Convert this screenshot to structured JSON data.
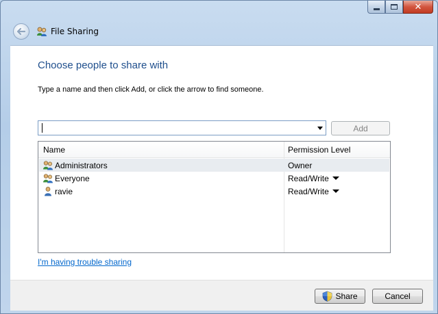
{
  "window": {
    "title": "File Sharing",
    "controls": {
      "minimize": "minimize",
      "maximize": "maximize",
      "close": "close"
    }
  },
  "dialog": {
    "heading": "Choose people to share with",
    "instruction": "Type a name and then click Add, or click the arrow to find someone.",
    "name_input": {
      "value": "",
      "placeholder": ""
    },
    "add_label": "Add",
    "table": {
      "columns": [
        "Name",
        "Permission Level"
      ],
      "rows": [
        {
          "name": "Administrators",
          "permission": "Owner",
          "icon": "group-icon",
          "has_dropdown": false,
          "selected": true
        },
        {
          "name": "Everyone",
          "permission": "Read/Write",
          "icon": "group-icon",
          "has_dropdown": true,
          "selected": false
        },
        {
          "name": "ravie",
          "permission": "Read/Write",
          "icon": "user-icon",
          "has_dropdown": true,
          "selected": false
        }
      ]
    },
    "help_link": "I'm having trouble sharing"
  },
  "footer": {
    "share_label": "Share",
    "cancel_label": "Cancel"
  },
  "colors": {
    "heading": "#1e4e8c",
    "link": "#0066cc",
    "glass": "#b9d1ea",
    "close_button": "#c23a22"
  }
}
